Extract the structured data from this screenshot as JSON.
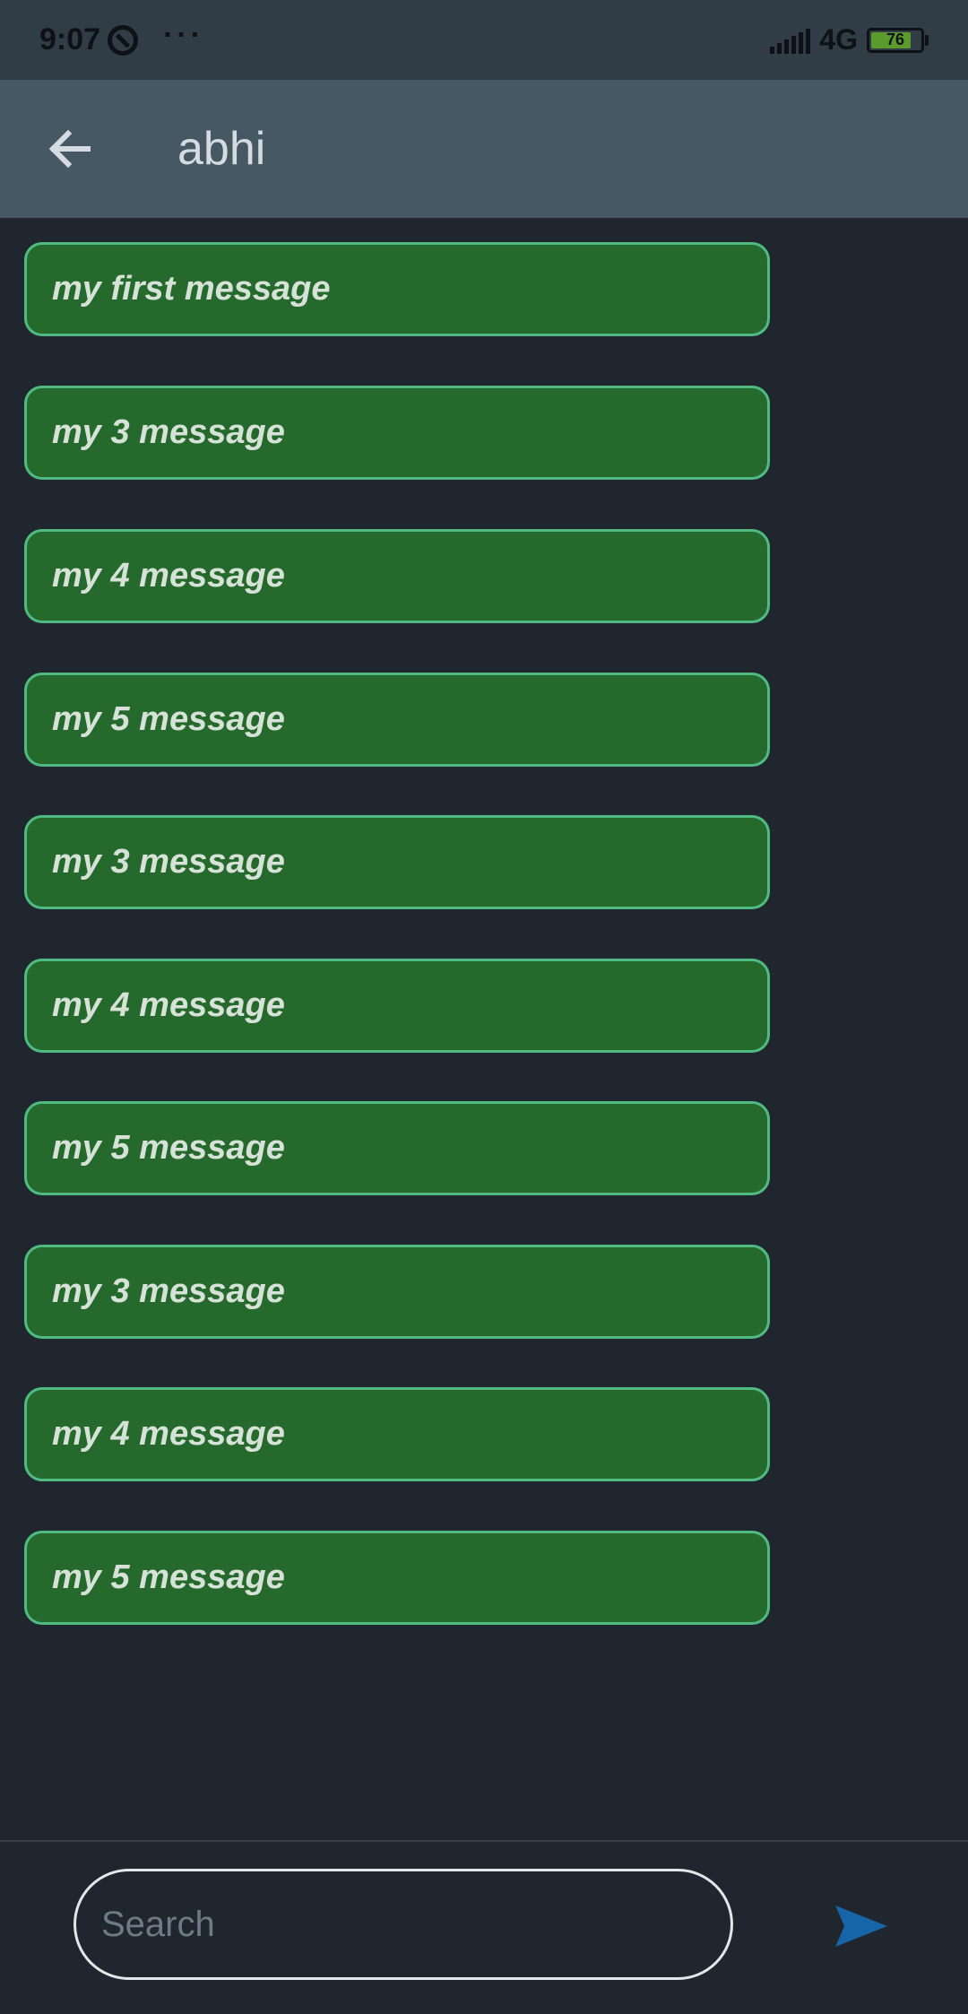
{
  "status_bar": {
    "time": "9:07",
    "more": "···",
    "network": "4G",
    "battery_level": "76"
  },
  "app_bar": {
    "back_icon": "arrow-left-icon",
    "title": "abhi"
  },
  "messages": [
    {
      "text": "my first message"
    },
    {
      "text": "my 3 message"
    },
    {
      "text": "my 4 message"
    },
    {
      "text": "my 5 message"
    },
    {
      "text": "my 3 message"
    },
    {
      "text": "my 4 message"
    },
    {
      "text": "my 5 message"
    },
    {
      "text": "my 3 message"
    },
    {
      "text": "my 4 message"
    },
    {
      "text": "my 5 message"
    }
  ],
  "input_bar": {
    "placeholder": "Search",
    "send_icon": "send-icon"
  },
  "colors": {
    "background": "#20262e",
    "app_bar": "#455864",
    "status_bar": "#303c46",
    "bubble_fill": "#256a2c",
    "bubble_border": "#4fbb83",
    "send_accent": "#1565a8"
  }
}
